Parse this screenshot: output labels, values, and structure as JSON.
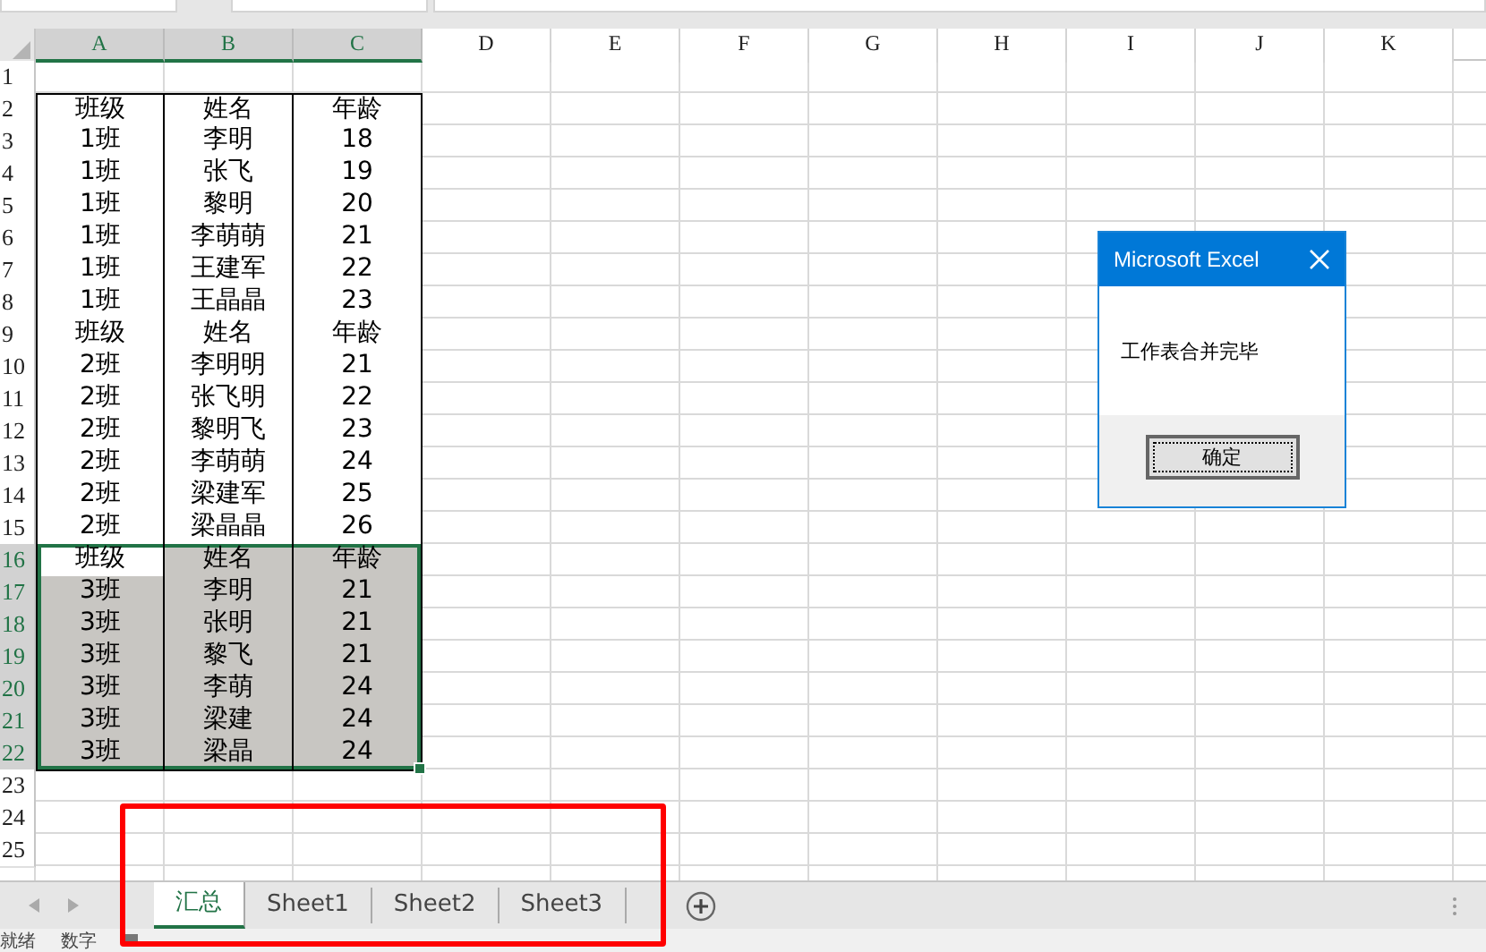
{
  "columns": [
    {
      "label": "A",
      "selected": true
    },
    {
      "label": "B",
      "selected": true
    },
    {
      "label": "C",
      "selected": true
    },
    {
      "label": "D",
      "selected": false
    },
    {
      "label": "E",
      "selected": false
    },
    {
      "label": "F",
      "selected": false
    },
    {
      "label": "G",
      "selected": false
    },
    {
      "label": "H",
      "selected": false
    },
    {
      "label": "I",
      "selected": false
    },
    {
      "label": "J",
      "selected": false
    },
    {
      "label": "K",
      "selected": false
    }
  ],
  "rows": [
    {
      "number": "1",
      "selected": false,
      "cells": []
    },
    {
      "number": "2",
      "selected": false,
      "cells": [
        {
          "text": "班级",
          "selected": false
        },
        {
          "text": "姓名",
          "selected": false
        },
        {
          "text": "年龄",
          "selected": false
        }
      ]
    },
    {
      "number": "3",
      "selected": false,
      "cells": [
        {
          "text": "1班",
          "selected": false
        },
        {
          "text": "李明",
          "selected": false
        },
        {
          "text": "18",
          "selected": false
        }
      ]
    },
    {
      "number": "4",
      "selected": false,
      "cells": [
        {
          "text": "1班",
          "selected": false
        },
        {
          "text": "张飞",
          "selected": false
        },
        {
          "text": "19",
          "selected": false
        }
      ]
    },
    {
      "number": "5",
      "selected": false,
      "cells": [
        {
          "text": "1班",
          "selected": false
        },
        {
          "text": "黎明",
          "selected": false
        },
        {
          "text": "20",
          "selected": false
        }
      ]
    },
    {
      "number": "6",
      "selected": false,
      "cells": [
        {
          "text": "1班",
          "selected": false
        },
        {
          "text": "李萌萌",
          "selected": false
        },
        {
          "text": "21",
          "selected": false
        }
      ]
    },
    {
      "number": "7",
      "selected": false,
      "cells": [
        {
          "text": "1班",
          "selected": false
        },
        {
          "text": "王建军",
          "selected": false
        },
        {
          "text": "22",
          "selected": false
        }
      ]
    },
    {
      "number": "8",
      "selected": false,
      "cells": [
        {
          "text": "1班",
          "selected": false
        },
        {
          "text": "王晶晶",
          "selected": false
        },
        {
          "text": "23",
          "selected": false
        }
      ]
    },
    {
      "number": "9",
      "selected": false,
      "cells": [
        {
          "text": "班级",
          "selected": false
        },
        {
          "text": "姓名",
          "selected": false
        },
        {
          "text": "年龄",
          "selected": false
        }
      ]
    },
    {
      "number": "10",
      "selected": false,
      "cells": [
        {
          "text": "2班",
          "selected": false
        },
        {
          "text": "李明明",
          "selected": false
        },
        {
          "text": "21",
          "selected": false
        }
      ]
    },
    {
      "number": "11",
      "selected": false,
      "cells": [
        {
          "text": "2班",
          "selected": false
        },
        {
          "text": "张飞明",
          "selected": false
        },
        {
          "text": "22",
          "selected": false
        }
      ]
    },
    {
      "number": "12",
      "selected": false,
      "cells": [
        {
          "text": "2班",
          "selected": false
        },
        {
          "text": "黎明飞",
          "selected": false
        },
        {
          "text": "23",
          "selected": false
        }
      ]
    },
    {
      "number": "13",
      "selected": false,
      "cells": [
        {
          "text": "2班",
          "selected": false
        },
        {
          "text": "李萌萌",
          "selected": false
        },
        {
          "text": "24",
          "selected": false
        }
      ]
    },
    {
      "number": "14",
      "selected": false,
      "cells": [
        {
          "text": "2班",
          "selected": false
        },
        {
          "text": "梁建军",
          "selected": false
        },
        {
          "text": "25",
          "selected": false
        }
      ]
    },
    {
      "number": "15",
      "selected": false,
      "cells": [
        {
          "text": "2班",
          "selected": false
        },
        {
          "text": "梁晶晶",
          "selected": false
        },
        {
          "text": "26",
          "selected": false
        }
      ]
    },
    {
      "number": "16",
      "selected": true,
      "cells": [
        {
          "text": "班级",
          "selected": false
        },
        {
          "text": "姓名",
          "selected": true
        },
        {
          "text": "年龄",
          "selected": true
        }
      ]
    },
    {
      "number": "17",
      "selected": true,
      "cells": [
        {
          "text": "3班",
          "selected": true
        },
        {
          "text": "李明",
          "selected": true
        },
        {
          "text": "21",
          "selected": true
        }
      ]
    },
    {
      "number": "18",
      "selected": true,
      "cells": [
        {
          "text": "3班",
          "selected": true
        },
        {
          "text": "张明",
          "selected": true
        },
        {
          "text": "21",
          "selected": true
        }
      ]
    },
    {
      "number": "19",
      "selected": true,
      "cells": [
        {
          "text": "3班",
          "selected": true
        },
        {
          "text": "黎飞",
          "selected": true
        },
        {
          "text": "21",
          "selected": true
        }
      ]
    },
    {
      "number": "20",
      "selected": true,
      "cells": [
        {
          "text": "3班",
          "selected": true
        },
        {
          "text": "李萌",
          "selected": true
        },
        {
          "text": "24",
          "selected": true
        }
      ]
    },
    {
      "number": "21",
      "selected": true,
      "cells": [
        {
          "text": "3班",
          "selected": true
        },
        {
          "text": "梁建",
          "selected": true
        },
        {
          "text": "24",
          "selected": true
        }
      ]
    },
    {
      "number": "22",
      "selected": true,
      "cells": [
        {
          "text": "3班",
          "selected": true
        },
        {
          "text": "梁晶",
          "selected": true
        },
        {
          "text": "24",
          "selected": true
        }
      ]
    },
    {
      "number": "23",
      "selected": false,
      "cells": []
    },
    {
      "number": "24",
      "selected": false,
      "cells": []
    },
    {
      "number": "25",
      "selected": false,
      "cells": []
    }
  ],
  "sheet_tabs": [
    {
      "label": "汇总",
      "selected": true
    },
    {
      "label": "Sheet1",
      "selected": false
    },
    {
      "label": "Sheet2",
      "selected": false
    },
    {
      "label": "Sheet3",
      "selected": false
    }
  ],
  "status_bar": {
    "items": [
      "就绪",
      "数字"
    ]
  },
  "dialog": {
    "title": "Microsoft Excel",
    "message": "工作表合并完毕",
    "button": "确定"
  }
}
